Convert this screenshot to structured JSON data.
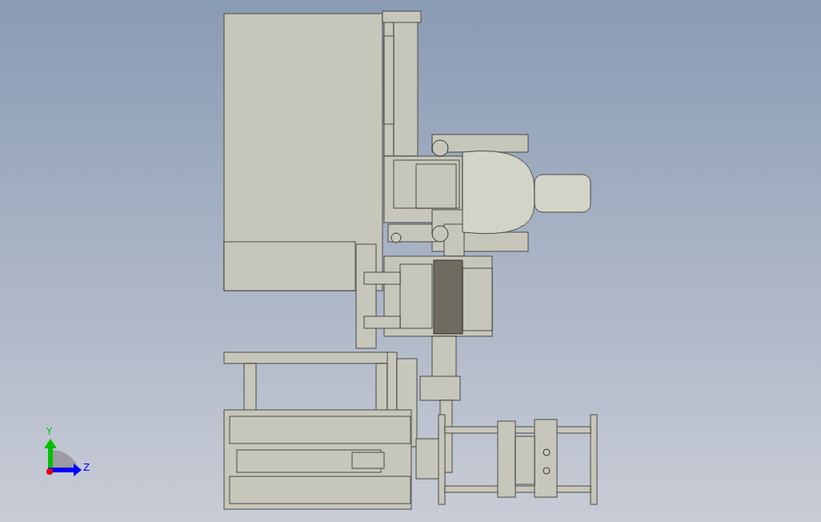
{
  "viewport": {
    "triad": {
      "axes": [
        {
          "label": "Y",
          "color": "#00c000"
        },
        {
          "label": "Z",
          "color": "#0000ff"
        }
      ]
    }
  }
}
